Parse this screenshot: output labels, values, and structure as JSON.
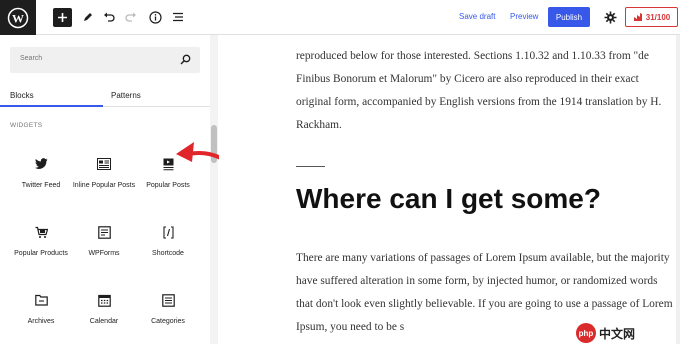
{
  "topbar": {
    "save_draft": "Save draft",
    "preview": "Preview",
    "publish": "Publish",
    "score": "31/100"
  },
  "sidebar": {
    "search_placeholder": "Search",
    "tabs": [
      "Blocks",
      "Patterns"
    ],
    "section": "WIDGETS",
    "blocks": [
      {
        "label": "Twitter Feed",
        "icon": "twitter-icon"
      },
      {
        "label": "Inline Popular Posts",
        "icon": "inline-posts-icon"
      },
      {
        "label": "Popular Posts",
        "icon": "popular-posts-icon"
      },
      {
        "label": "Popular Products",
        "icon": "cart-icon"
      },
      {
        "label": "WPForms",
        "icon": "wpforms-icon"
      },
      {
        "label": "Shortcode",
        "icon": "shortcode-icon"
      },
      {
        "label": "Archives",
        "icon": "archives-icon"
      },
      {
        "label": "Calendar",
        "icon": "calendar-icon"
      },
      {
        "label": "Categories",
        "icon": "categories-icon"
      }
    ]
  },
  "editor": {
    "para1": "reproduced below for those interested. Sections 1.10.32 and 1.10.33 from \"de Finibus Bonorum et Malorum\" by Cicero are also reproduced in their exact original form, accompanied by English versions from the 1914 translation by H. Rackham.",
    "heading": "Where can I get some?",
    "para2": "There are many variations of passages of Lorem Ipsum available, but the majority have suffered alteration in some form, by injected humor, or randomized words that don't look even slightly believable. If you are going to use a passage of Lorem Ipsum, you need to be s"
  },
  "watermark": {
    "badge": "php",
    "text": "中文网"
  },
  "colors": {
    "accent": "#3858e9",
    "arrow": "#e0262b",
    "score": "#d63638"
  }
}
